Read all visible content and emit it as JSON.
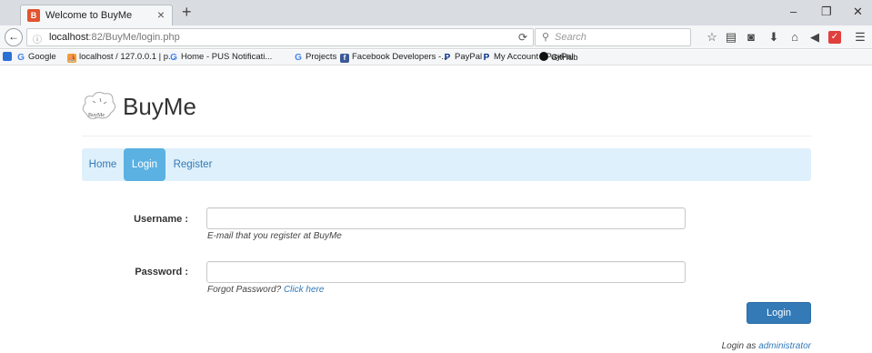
{
  "browser": {
    "tab_title": "Welcome to BuyMe",
    "tab_close": "×",
    "new_tab": "+",
    "url_host": "localhost",
    "url_path": ":82/BuyMe/login.php",
    "search_placeholder": "Search",
    "bookmarks": [
      {
        "label": "Google",
        "icon": "google-icon"
      },
      {
        "label": "localhost / 127.0.0.1 | p...",
        "icon": "phpmyadmin-icon"
      },
      {
        "label": "Home - PUS Notificati...",
        "icon": "google-icon"
      },
      {
        "label": "Projects",
        "icon": "google-icon"
      },
      {
        "label": "Facebook Developers -...",
        "icon": "facebook-icon"
      },
      {
        "label": "PayPal",
        "icon": "paypal-icon"
      },
      {
        "label": "My Account - PayPal",
        "icon": "paypal-icon"
      },
      {
        "label": "GitHub",
        "icon": "github-icon"
      }
    ]
  },
  "site": {
    "brand": "BuyMe",
    "logo_text": "BuyMe",
    "nav": [
      {
        "label": "Home",
        "active": false
      },
      {
        "label": "Login",
        "active": true
      },
      {
        "label": "Register",
        "active": false
      }
    ]
  },
  "form": {
    "username_label": "Username :",
    "username_value": "",
    "username_help": "E-mail that you register at BuyMe",
    "password_label": "Password :",
    "password_value": "",
    "password_help_prefix": "Forgot Password?",
    "password_help_link": "Click here",
    "submit_label": "Login"
  },
  "footer": {
    "admin_prefix": "Login as",
    "admin_link": "administrator"
  },
  "colors": {
    "nav_bg": "#def0fb",
    "nav_active": "#5bb1e1",
    "link": "#337ab7",
    "button": "#337ab7"
  }
}
